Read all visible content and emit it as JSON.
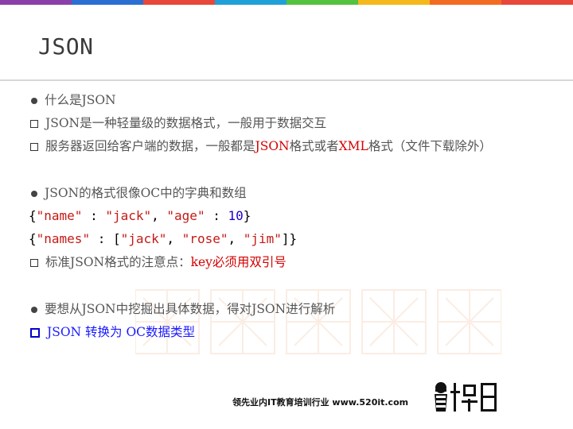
{
  "colors": {
    "top_bar": [
      "#8b3fa8",
      "#2a6fd1",
      "#e8473b",
      "#1fa0d8",
      "#53c23f",
      "#f5b81c",
      "#f36b21",
      "#e8473b"
    ],
    "accent_red": "#d40000",
    "accent_blue": "#1a1aff"
  },
  "slide": {
    "title": "JSON"
  },
  "items": {
    "l1": "什么是JSON",
    "l2": "JSON是一种轻量级的数据格式，一般用于数据交互",
    "l3_a": "服务器返回给客户端的数据，一般都是",
    "l3_json": "JSON",
    "l3_b": "格式或者",
    "l3_xml": "XML",
    "l3_c": "格式（文件下载除外）",
    "l4": "JSON的格式很像OC中的字典和数组",
    "c1": {
      "open": "{",
      "k1": "\"name\"",
      "sep1": " : ",
      "v1": "\"jack\"",
      "comma": ", ",
      "k2": "\"age\"",
      "sep2": " : ",
      "v2": "10",
      "close": "}"
    },
    "c2": {
      "open": "{",
      "k1": "\"names\"",
      "sep": " : [",
      "v1": "\"jack\"",
      "comma1": ", ",
      "v2": "\"rose\"",
      "comma2": ", ",
      "v3": "\"jim\"",
      "close": "]}"
    },
    "l5_a": "标准JSON格式的注意点：",
    "l5_b": "key必须用双引号",
    "l6": "要想从JSON中挖掘出具体数据，得对JSON进行解析",
    "l7": "JSON 转换为 OC数据类型"
  },
  "footer": {
    "text": "领先业内IT教育培训行业 www.520it.com"
  }
}
